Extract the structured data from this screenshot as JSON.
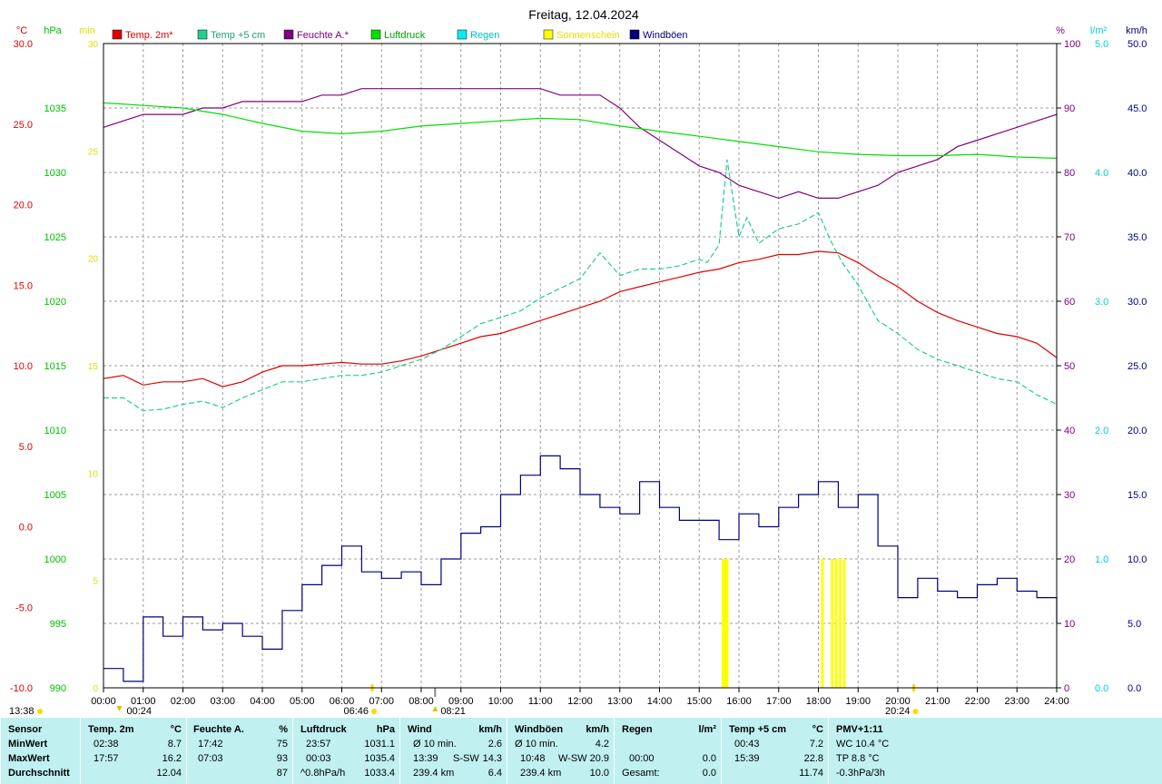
{
  "title": "Freitag, 12.04.2024",
  "legend": [
    {
      "label": "Temp. 2m*",
      "color": "#e00000",
      "text_color": "#e00000"
    },
    {
      "label": "Temp +5 cm",
      "color": "#20d090",
      "text_color": "#20a070"
    },
    {
      "label": "Feuchte A.*",
      "color": "#800080",
      "text_color": "#800080"
    },
    {
      "label": "Luftdruck",
      "color": "#00e000",
      "text_color": "#00a000"
    },
    {
      "label": "Regen",
      "color": "#00f0f0",
      "text_color": "#00c0c0"
    },
    {
      "label": "Sonnenschein",
      "color": "#ffff00",
      "text_color": "#e0e000"
    },
    {
      "label": "Windböen",
      "color": "#000080",
      "text_color": "#000080"
    }
  ],
  "axes": {
    "temp": {
      "unit": "°C",
      "color": "#e00000",
      "ticks": [
        "30.0",
        "25.0",
        "20.0",
        "15.0",
        "10.0",
        "5.0",
        "0.0",
        "-5.0",
        "-10.0"
      ]
    },
    "press": {
      "unit": "hPa",
      "color": "#00c000",
      "ticks": [
        "1035",
        "1030",
        "1025",
        "1020",
        "1015",
        "1010",
        "1005",
        "1000",
        "995",
        "990"
      ]
    },
    "sun": {
      "unit": "min",
      "color": "#e0e000",
      "ticks": [
        "30",
        "25",
        "20",
        "15",
        "10",
        "5",
        "0"
      ]
    },
    "hum": {
      "unit": "%",
      "color": "#800080",
      "ticks": [
        "100",
        "90",
        "80",
        "70",
        "60",
        "50",
        "40",
        "30",
        "20",
        "10",
        "0"
      ]
    },
    "rain": {
      "unit": "l/m²",
      "color": "#00d0d0",
      "ticks": [
        "5.0",
        "4.0",
        "3.0",
        "2.0",
        "1.0",
        "0.0"
      ]
    },
    "wind": {
      "unit": "km/h",
      "color": "#000080",
      "ticks": [
        "50.0",
        "45.0",
        "40.0",
        "35.0",
        "30.0",
        "25.0",
        "20.0",
        "15.0",
        "10.0",
        "5.0",
        "0.0"
      ]
    },
    "time": {
      "ticks": [
        "00:00",
        "01:00",
        "02:00",
        "03:00",
        "04:00",
        "05:00",
        "06:00",
        "07:00",
        "08:00",
        "09:00",
        "10:00",
        "11:00",
        "12:00",
        "13:00",
        "14:00",
        "15:00",
        "16:00",
        "17:00",
        "18:00",
        "19:00",
        "20:00",
        "21:00",
        "22:00",
        "23:00",
        "24:00"
      ]
    }
  },
  "markers": {
    "now": "13:38",
    "moonset": "00:24",
    "sunrise": "06:46",
    "moonrise": "08:21",
    "sunset": "20:24"
  },
  "chart_data": {
    "type": "line",
    "title": "Freitag, 12.04.2024",
    "x_unit": "hour",
    "xlim": [
      0,
      24
    ],
    "series": [
      {
        "name": "Temp. 2m*",
        "axis": "temp",
        "ylim": [
          -10,
          30
        ],
        "color": "#e00000",
        "x": [
          0,
          0.5,
          1,
          1.5,
          2,
          2.5,
          3,
          3.5,
          4,
          4.5,
          5,
          5.5,
          6,
          6.5,
          7,
          7.5,
          8,
          8.5,
          9,
          9.5,
          10,
          10.5,
          11,
          11.5,
          12,
          12.5,
          13,
          13.5,
          14,
          14.5,
          15,
          15.5,
          16,
          16.5,
          17,
          17.5,
          18,
          18.5,
          19,
          19.5,
          20,
          20.5,
          21,
          21.5,
          22,
          22.5,
          23,
          23.5,
          24
        ],
        "y": [
          9.2,
          9.4,
          8.8,
          9.0,
          9.0,
          9.2,
          8.7,
          9.0,
          9.6,
          10.0,
          10.0,
          10.1,
          10.2,
          10.1,
          10.1,
          10.3,
          10.6,
          11.0,
          11.4,
          11.8,
          12.0,
          12.4,
          12.8,
          13.2,
          13.6,
          14.0,
          14.6,
          14.9,
          15.2,
          15.5,
          15.8,
          16.0,
          16.4,
          16.6,
          16.9,
          16.9,
          17.1,
          17.0,
          16.4,
          15.6,
          14.9,
          14.0,
          13.3,
          12.8,
          12.4,
          12.0,
          11.8,
          11.4,
          10.5
        ]
      },
      {
        "name": "Temp +5 cm",
        "axis": "temp",
        "ylim": [
          -10,
          30
        ],
        "color": "#20d090",
        "x": [
          0,
          0.5,
          1,
          1.5,
          2,
          2.5,
          3,
          3.5,
          4,
          4.5,
          5,
          5.5,
          6,
          6.5,
          7,
          7.5,
          8,
          8.5,
          9,
          9.5,
          10,
          10.5,
          11,
          11.5,
          12,
          12.5,
          13,
          13.5,
          14,
          14.5,
          15,
          15.2,
          15.5,
          15.7,
          16,
          16.2,
          16.5,
          17,
          17.5,
          18,
          18.3,
          18.6,
          19,
          19.5,
          20,
          20.5,
          21,
          21.5,
          22,
          22.5,
          23,
          23.5,
          24
        ],
        "y": [
          8.0,
          8.0,
          7.2,
          7.3,
          7.6,
          7.8,
          7.4,
          8.0,
          8.5,
          9.0,
          9.0,
          9.2,
          9.4,
          9.4,
          9.6,
          10.0,
          10.4,
          11.0,
          11.8,
          12.6,
          13.0,
          13.4,
          14.2,
          14.8,
          15.4,
          17.0,
          15.6,
          16.0,
          16.0,
          16.2,
          16.6,
          16.4,
          17.5,
          22.8,
          18.0,
          19.2,
          17.6,
          18.5,
          18.8,
          19.5,
          17.8,
          16.4,
          15.0,
          12.8,
          12.0,
          11.0,
          10.4,
          10.0,
          9.6,
          9.2,
          9.0,
          8.2,
          7.6
        ]
      },
      {
        "name": "Feuchte A.*",
        "axis": "hum",
        "ylim": [
          0,
          100
        ],
        "color": "#800080",
        "x": [
          0,
          0.5,
          1,
          1.5,
          2,
          2.5,
          3,
          3.5,
          4,
          4.5,
          5,
          5.5,
          6,
          6.5,
          7,
          7.5,
          8,
          8.5,
          9,
          9.5,
          10,
          10.5,
          11,
          11.5,
          12,
          12.5,
          13,
          13.5,
          14,
          14.5,
          15,
          15.5,
          16,
          16.5,
          17,
          17.5,
          18,
          18.5,
          19,
          19.5,
          20,
          20.5,
          21,
          21.5,
          22,
          22.5,
          23,
          23.5,
          24
        ],
        "y": [
          87,
          88,
          89,
          89,
          89,
          90,
          90,
          91,
          91,
          91,
          91,
          92,
          92,
          93,
          93,
          93,
          93,
          93,
          93,
          93,
          93,
          93,
          93,
          92,
          92,
          92,
          90,
          87,
          85,
          83,
          81,
          80,
          78,
          77,
          76,
          77,
          76,
          76,
          77,
          78,
          80,
          81,
          82,
          84,
          85,
          86,
          87,
          88,
          89
        ]
      },
      {
        "name": "Luftdruck",
        "axis": "press",
        "ylim": [
          990,
          1040
        ],
        "color": "#00e000",
        "x": [
          0,
          1,
          2,
          3,
          4,
          5,
          6,
          7,
          8,
          9,
          10,
          11,
          12,
          13,
          14,
          15,
          16,
          17,
          18,
          19,
          20,
          21,
          22,
          23,
          24
        ],
        "y": [
          1035.4,
          1035.2,
          1035.0,
          1034.5,
          1033.8,
          1033.2,
          1033.0,
          1033.2,
          1033.6,
          1033.8,
          1034.0,
          1034.2,
          1034.1,
          1033.6,
          1033.2,
          1032.8,
          1032.4,
          1032.0,
          1031.6,
          1031.4,
          1031.3,
          1031.3,
          1031.4,
          1031.2,
          1031.1
        ]
      },
      {
        "name": "Windböen",
        "axis": "wind",
        "ylim": [
          0,
          50
        ],
        "color": "#000080",
        "x": [
          0,
          0.5,
          1,
          1.5,
          2,
          2.5,
          3,
          3.5,
          4,
          4.5,
          5,
          5.5,
          6,
          6.5,
          7,
          7.5,
          8,
          8.5,
          9,
          9.5,
          10,
          10.5,
          11,
          11.5,
          12,
          12.5,
          13,
          13.5,
          14,
          14.5,
          15,
          15.5,
          16,
          16.5,
          17,
          17.5,
          18,
          18.5,
          19,
          19.5,
          20,
          20.5,
          21,
          21.5,
          22,
          22.5,
          23,
          23.5,
          24
        ],
        "y": [
          1.5,
          0.5,
          5.5,
          4.0,
          5.5,
          4.5,
          5.0,
          4.0,
          3.0,
          6.0,
          8.0,
          9.5,
          11.0,
          9.0,
          8.5,
          9.0,
          8.0,
          10.0,
          12.0,
          12.5,
          15.0,
          16.5,
          18.0,
          17.0,
          15.0,
          14.0,
          13.5,
          16.0,
          14.0,
          13.0,
          13.0,
          11.5,
          13.5,
          12.5,
          14.0,
          15.0,
          16.0,
          14.0,
          15.0,
          11.0,
          7.0,
          8.5,
          7.5,
          7.0,
          8.0,
          8.5,
          7.5,
          7.0,
          5.0
        ]
      },
      {
        "name": "Sonnenschein",
        "axis": "sun",
        "ylim": [
          0,
          30
        ],
        "type": "bar",
        "color": "#ffff00",
        "x": [
          15.6,
          15.65,
          15.7,
          18.1,
          18.35,
          18.45,
          18.55,
          18.65
        ],
        "y": [
          6,
          6,
          6,
          6,
          6,
          6,
          6,
          6
        ]
      },
      {
        "name": "Regen",
        "axis": "rain",
        "ylim": [
          0,
          5
        ],
        "type": "bar",
        "color": "#00f0f0",
        "x": [],
        "y": []
      }
    ]
  },
  "footer": {
    "sensor": {
      "header": "Sensor",
      "rows": [
        "MinWert",
        "MaxWert",
        "Durchschnitt"
      ]
    },
    "temp2m": {
      "header": "Temp. 2m",
      "unit": "°C",
      "min_time": "02:38",
      "min": "8.7",
      "max_time": "17:57",
      "max": "16.2",
      "avg": "12.04"
    },
    "feuchte": {
      "header": "Feuchte A.",
      "unit": "%",
      "min_time": "17:42",
      "min": "75",
      "max_time": "07:03",
      "max": "93",
      "avg": "87"
    },
    "luftdruck": {
      "header": "Luftdruck",
      "unit": "hPa",
      "min_time": "23:57",
      "min": "1031.1",
      "max_time": "00:03",
      "max": "1035.4",
      "avg_label": "^0.8hPa/h",
      "avg": "1033.4"
    },
    "wind": {
      "header": "Wind",
      "unit": "km/h",
      "min_label": "Ø 10 min.",
      "min": "2.6",
      "max_time": "13:39",
      "max_dir": "S-SW",
      "max": "14.3",
      "avg_label": "239.4 km",
      "avg": "6.4"
    },
    "windboeen": {
      "header": "Windböen",
      "unit": "km/h",
      "min_label": "Ø 10 min.",
      "min": "4.2",
      "max_time": "10:48",
      "max_dir": "W-SW",
      "max": "20.9",
      "avg_label": "239.4 km",
      "avg": "10.0"
    },
    "regen": {
      "header": "Regen",
      "unit": "l/m²",
      "max_time": "00:00",
      "max": "0.0",
      "avg_label": "Gesamt:",
      "avg": "0.0"
    },
    "temp5cm": {
      "header": "Temp +5 cm",
      "unit": "°C",
      "min_time": "00:43",
      "min": "7.2",
      "max_time": "15:39",
      "max": "22.8",
      "avg": "11.74"
    },
    "pmv": {
      "header": "PMV+1:11",
      "line1": "WC 10.4 °C",
      "line2": "TP 8.8 °C",
      "line3": "-0.3hPa/3h"
    }
  }
}
